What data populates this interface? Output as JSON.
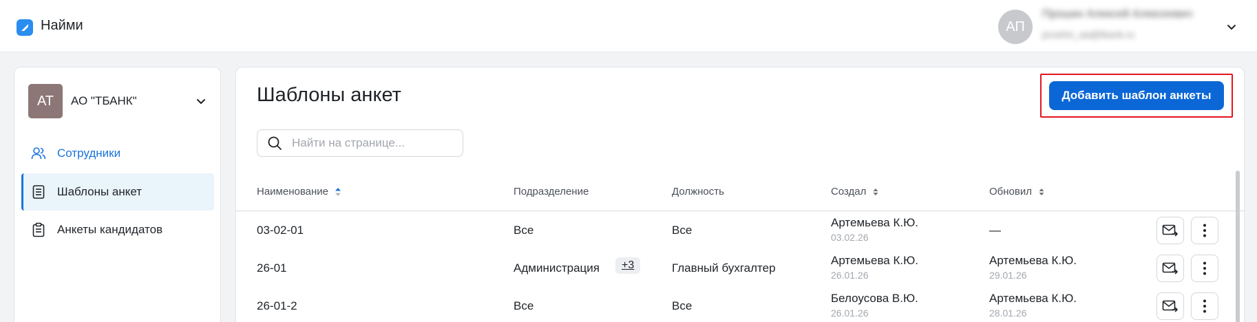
{
  "app": {
    "name": "Найми",
    "colors": {
      "accent": "#0b67d6",
      "link": "#1a73d9",
      "highlight": "#e3141d"
    }
  },
  "user": {
    "initials": "АП",
    "name": "Прошин Алексей Алексеевич",
    "email": "proshin_aa@tbank.ru"
  },
  "sidebar": {
    "org": {
      "initials": "АТ",
      "name": "АО \"ТБАНК\""
    },
    "items": [
      {
        "label": "Сотрудники",
        "icon": "users-icon",
        "state": "link"
      },
      {
        "label": "Шаблоны анкет",
        "icon": "document-icon",
        "state": "active"
      },
      {
        "label": "Анкеты кандидатов",
        "icon": "clipboard-icon",
        "state": "normal"
      }
    ]
  },
  "main": {
    "title": "Шаблоны анкет",
    "add_button": "Добавить шаблон анкеты",
    "search_placeholder": "Найти на странице...",
    "columns": {
      "name": "Наименование",
      "department": "Подразделение",
      "position": "Должность",
      "created": "Создал",
      "updated": "Обновил"
    },
    "rows": [
      {
        "name": "03-02-01",
        "department": "Все",
        "department_extra": "",
        "position": "Все",
        "created_by": "Артемьева К.Ю.",
        "created_date": "03.02.26",
        "updated_by": "—",
        "updated_date": ""
      },
      {
        "name": "26-01",
        "department": "Администрация",
        "department_extra": "+3",
        "position": "Главный бухгалтер",
        "created_by": "Артемьева К.Ю.",
        "created_date": "26.01.26",
        "updated_by": "Артемьева К.Ю.",
        "updated_date": "29.01.26"
      },
      {
        "name": "26-01-2",
        "department": "Все",
        "department_extra": "",
        "position": "Все",
        "created_by": "Белоусова В.Ю.",
        "created_date": "26.01.26",
        "updated_by": "Артемьева К.Ю.",
        "updated_date": "28.01.26"
      }
    ]
  }
}
